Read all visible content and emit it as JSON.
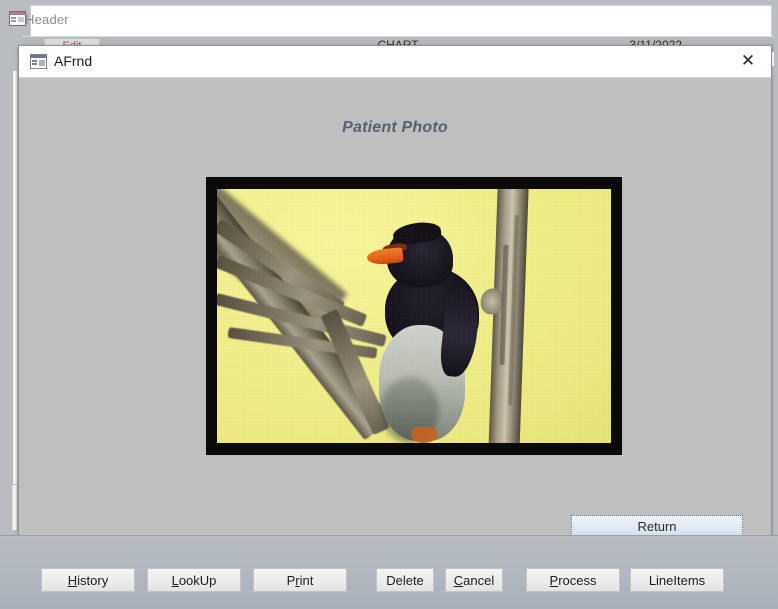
{
  "background_window": {
    "icon": "access-form-icon",
    "title": "Header",
    "strip": {
      "edit_label": "Edit",
      "center_label": "CHART",
      "date_label": "3/11/2022"
    }
  },
  "dialog": {
    "icon": "access-form-icon",
    "title": "AFrnd",
    "close_label": "✕",
    "caption": "Patient Photo",
    "photo": {
      "alt": "Bird perched on tree branches against a yellow background",
      "frame_color": "#0b0b0b",
      "background_color": "#eeec84"
    },
    "return_button": "Return"
  },
  "command_bar": {
    "buttons": [
      {
        "label": "History",
        "accel": "H",
        "name": "history-button"
      },
      {
        "label": "LookUp",
        "accel": "L",
        "name": "lookup-button"
      },
      {
        "label": "Print",
        "accel": "r",
        "name": "print-button"
      },
      {
        "label": "Delete",
        "accel": "",
        "name": "delete-button"
      },
      {
        "label": "Cancel",
        "accel": "C",
        "name": "cancel-button"
      },
      {
        "label": "Process",
        "accel": "P",
        "name": "process-button"
      },
      {
        "label": "LineItems",
        "accel": "",
        "name": "lineitems-button"
      }
    ]
  },
  "colors": {
    "dialog_body": "#bfbfbf",
    "caption_text": "#55616f",
    "bottom_bar": "#b2b8c0",
    "return_button": "#e2eaf4"
  }
}
